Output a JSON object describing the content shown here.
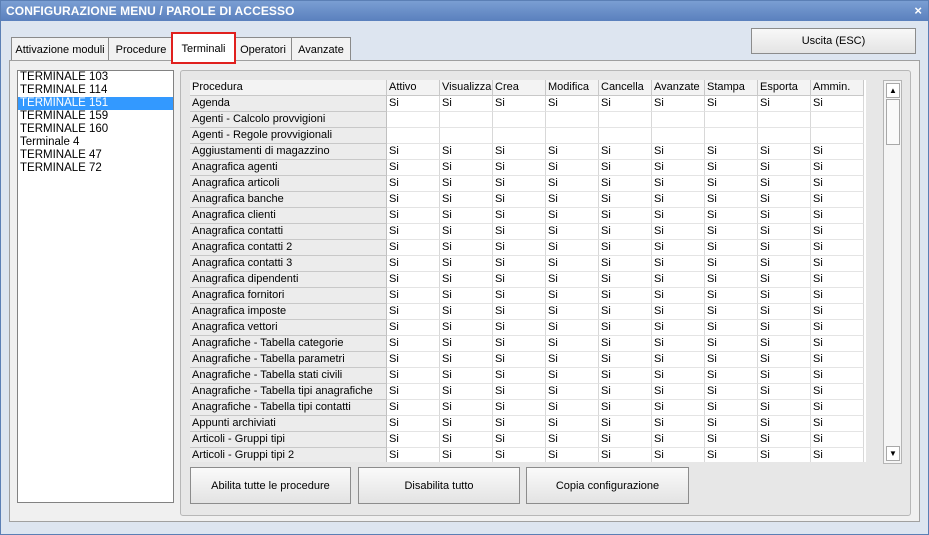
{
  "window": {
    "title": "CONFIGURAZIONE MENU / PAROLE DI ACCESSO",
    "close_glyph": "×"
  },
  "tabs": [
    {
      "label": "Attivazione moduli"
    },
    {
      "label": "Procedure"
    },
    {
      "label": "Terminali"
    },
    {
      "label": "Operatori"
    },
    {
      "label": "Avanzate"
    }
  ],
  "exit_button": {
    "label": "Uscita (ESC)"
  },
  "terminals": [
    "TERMINALE 103",
    "TERMINALE 114",
    "TERMINALE 151",
    "TERMINALE 159",
    "TERMINALE 160",
    "Terminale 4",
    "TERMINALE 47",
    "TERMINALE 72"
  ],
  "selected_terminal_index": 2,
  "grid": {
    "columns": [
      "Procedura",
      "Attivo",
      "Visualizza",
      "Crea",
      "Modifica",
      "Cancella",
      "Avanzate",
      "Stampa",
      "Esporta",
      "Ammin."
    ],
    "rows": [
      {
        "name": "Agenda",
        "values": [
          "Si",
          "Si",
          "Si",
          "Si",
          "Si",
          "Si",
          "Si",
          "Si",
          "Si"
        ]
      },
      {
        "name": "Agenti - Calcolo provvigioni",
        "values": [
          "",
          "",
          "",
          "",
          "",
          "",
          "",
          "",
          ""
        ]
      },
      {
        "name": "Agenti - Regole provvigionali",
        "values": [
          "",
          "",
          "",
          "",
          "",
          "",
          "",
          "",
          ""
        ]
      },
      {
        "name": "Aggiustamenti di magazzino",
        "values": [
          "Si",
          "Si",
          "Si",
          "Si",
          "Si",
          "Si",
          "Si",
          "Si",
          "Si"
        ]
      },
      {
        "name": "Anagrafica agenti",
        "values": [
          "Si",
          "Si",
          "Si",
          "Si",
          "Si",
          "Si",
          "Si",
          "Si",
          "Si"
        ]
      },
      {
        "name": "Anagrafica articoli",
        "values": [
          "Si",
          "Si",
          "Si",
          "Si",
          "Si",
          "Si",
          "Si",
          "Si",
          "Si"
        ]
      },
      {
        "name": "Anagrafica banche",
        "values": [
          "Si",
          "Si",
          "Si",
          "Si",
          "Si",
          "Si",
          "Si",
          "Si",
          "Si"
        ]
      },
      {
        "name": "Anagrafica clienti",
        "values": [
          "Si",
          "Si",
          "Si",
          "Si",
          "Si",
          "Si",
          "Si",
          "Si",
          "Si"
        ]
      },
      {
        "name": "Anagrafica contatti",
        "values": [
          "Si",
          "Si",
          "Si",
          "Si",
          "Si",
          "Si",
          "Si",
          "Si",
          "Si"
        ]
      },
      {
        "name": "Anagrafica contatti 2",
        "values": [
          "Si",
          "Si",
          "Si",
          "Si",
          "Si",
          "Si",
          "Si",
          "Si",
          "Si"
        ]
      },
      {
        "name": "Anagrafica contatti 3",
        "values": [
          "Si",
          "Si",
          "Si",
          "Si",
          "Si",
          "Si",
          "Si",
          "Si",
          "Si"
        ]
      },
      {
        "name": "Anagrafica dipendenti",
        "values": [
          "Si",
          "Si",
          "Si",
          "Si",
          "Si",
          "Si",
          "Si",
          "Si",
          "Si"
        ]
      },
      {
        "name": "Anagrafica fornitori",
        "values": [
          "Si",
          "Si",
          "Si",
          "Si",
          "Si",
          "Si",
          "Si",
          "Si",
          "Si"
        ]
      },
      {
        "name": "Anagrafica imposte",
        "values": [
          "Si",
          "Si",
          "Si",
          "Si",
          "Si",
          "Si",
          "Si",
          "Si",
          "Si"
        ]
      },
      {
        "name": "Anagrafica vettori",
        "values": [
          "Si",
          "Si",
          "Si",
          "Si",
          "Si",
          "Si",
          "Si",
          "Si",
          "Si"
        ]
      },
      {
        "name": "Anagrafiche - Tabella categorie",
        "values": [
          "Si",
          "Si",
          "Si",
          "Si",
          "Si",
          "Si",
          "Si",
          "Si",
          "Si"
        ]
      },
      {
        "name": "Anagrafiche - Tabella parametri",
        "values": [
          "Si",
          "Si",
          "Si",
          "Si",
          "Si",
          "Si",
          "Si",
          "Si",
          "Si"
        ]
      },
      {
        "name": "Anagrafiche - Tabella stati civili",
        "values": [
          "Si",
          "Si",
          "Si",
          "Si",
          "Si",
          "Si",
          "Si",
          "Si",
          "Si"
        ]
      },
      {
        "name": "Anagrafiche - Tabella tipi anagrafiche",
        "values": [
          "Si",
          "Si",
          "Si",
          "Si",
          "Si",
          "Si",
          "Si",
          "Si",
          "Si"
        ]
      },
      {
        "name": "Anagrafiche - Tabella tipi contatti",
        "values": [
          "Si",
          "Si",
          "Si",
          "Si",
          "Si",
          "Si",
          "Si",
          "Si",
          "Si"
        ]
      },
      {
        "name": "Appunti archiviati",
        "values": [
          "Si",
          "Si",
          "Si",
          "Si",
          "Si",
          "Si",
          "Si",
          "Si",
          "Si"
        ]
      },
      {
        "name": "Articoli - Gruppi tipi",
        "values": [
          "Si",
          "Si",
          "Si",
          "Si",
          "Si",
          "Si",
          "Si",
          "Si",
          "Si"
        ]
      },
      {
        "name": "Articoli - Gruppi tipi 2",
        "values": [
          "Si",
          "Si",
          "Si",
          "Si",
          "Si",
          "Si",
          "Si",
          "Si",
          "Si"
        ]
      }
    ]
  },
  "scrollbar": {
    "up_glyph": "▲",
    "down_glyph": "▼"
  },
  "buttons": {
    "enable_all": "Abilita tutte le procedure",
    "disable_all": "Disabilita tutto",
    "copy_config": "Copia configurazione"
  },
  "colors": {
    "selection": "#3399ff",
    "active_tab_outline": "#e0201e",
    "titlebar": "#5a80bd"
  }
}
